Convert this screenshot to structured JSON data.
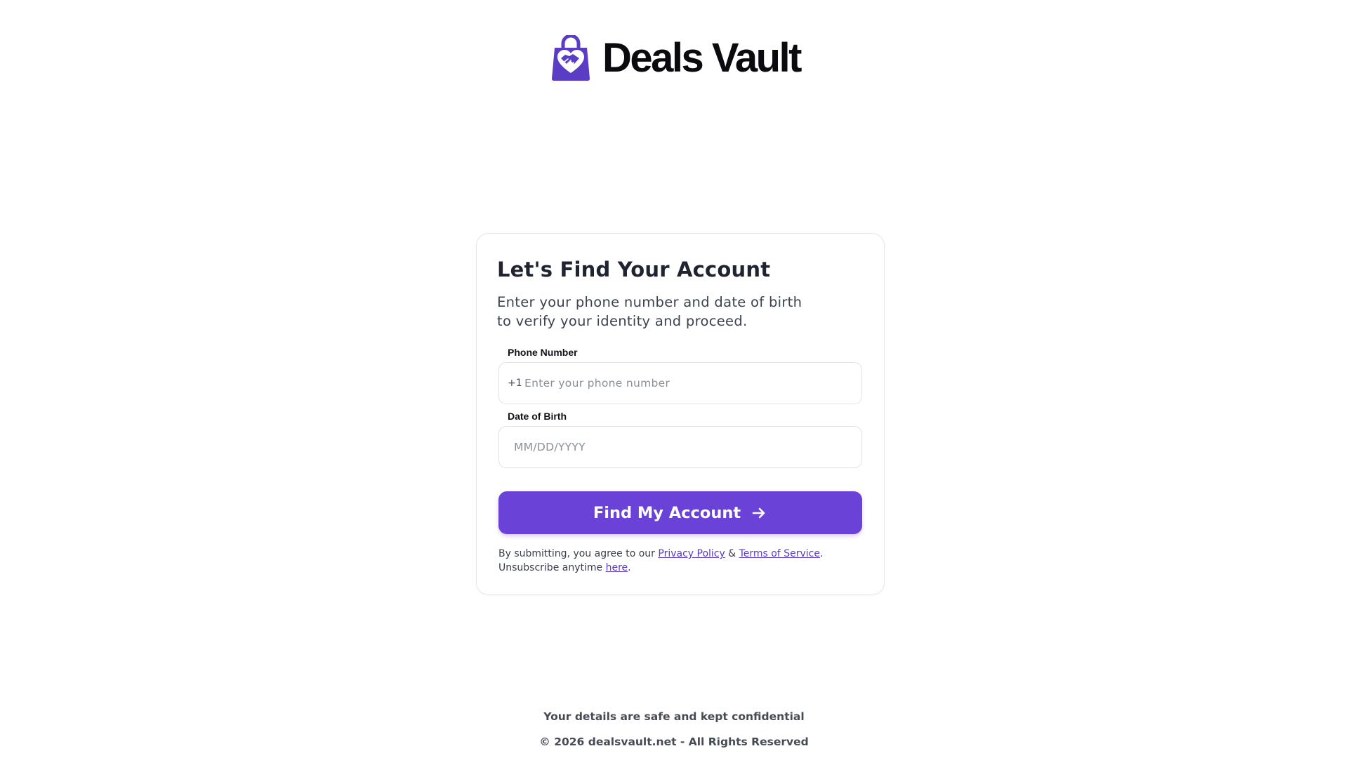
{
  "brand": {
    "name": "Deals Vault",
    "logo_icon": "shopping-bag-handshake-icon",
    "accent_color": "#6a42d8",
    "logo_color": "#5b3cc4"
  },
  "form": {
    "title": "Let's Find Your Account",
    "subtitle": "Enter your phone number and date of birth to verify your identity and proceed.",
    "phone": {
      "label": "Phone Number",
      "country_code": "+1",
      "placeholder": "Enter your phone number",
      "value": ""
    },
    "dob": {
      "label": "Date of Birth",
      "placeholder": "MM/DD/YYYY",
      "value": ""
    },
    "submit_label": "Find My Account",
    "submit_icon": "arrow-right-icon"
  },
  "legal": {
    "prefix": "By submitting, you agree to our ",
    "privacy_link": "Privacy Policy",
    "amp": " & ",
    "terms_link": "Terms of Service",
    "period1": ".",
    "unsubscribe_prefix": "Unsubscribe anytime ",
    "here_link": "here",
    "period2": "."
  },
  "footer": {
    "safety_note": "Your details are safe and kept confidential",
    "copyright": "© 2026 dealsvault.net - All Rights Reserved"
  }
}
